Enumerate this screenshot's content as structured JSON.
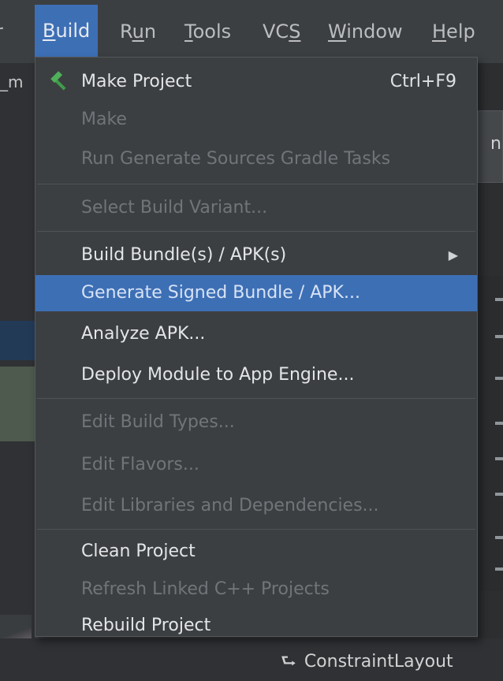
{
  "menubar": {
    "fragment": "r",
    "items": [
      "Build",
      "Run",
      "Tools",
      "VCS",
      "Window",
      "Help"
    ],
    "build": {
      "pre": "",
      "u": "B",
      "post": "uild"
    },
    "run": {
      "pre": "R",
      "u": "u",
      "post": "n"
    },
    "tools": {
      "pre": "",
      "u": "T",
      "post": "ools"
    },
    "vcs": {
      "pre": "VC",
      "u": "S",
      "post": ""
    },
    "window": {
      "pre": "",
      "u": "W",
      "post": "indow"
    },
    "help": {
      "pre": "",
      "u": "H",
      "post": "elp"
    }
  },
  "background": {
    "left_fragment": "_m",
    "right_tab": "nl",
    "constraint_label": "ConstraintLayout"
  },
  "build_menu": {
    "items": [
      {
        "label": "Make Project",
        "shortcut": "Ctrl+F9",
        "enabled": true,
        "icon": "hammer-icon"
      },
      {
        "label": "Make",
        "enabled": false
      },
      {
        "label": "Run Generate Sources Gradle Tasks",
        "enabled": false
      },
      {
        "label": "Select Build Variant...",
        "enabled": false
      },
      {
        "label": "Build Bundle(s) / APK(s)",
        "enabled": true,
        "submenu": true
      },
      {
        "label": "Generate Signed Bundle / APK...",
        "enabled": true,
        "selected": true
      },
      {
        "label": "Analyze APK...",
        "enabled": true
      },
      {
        "label": "Deploy Module to App Engine...",
        "enabled": true
      },
      {
        "label": "Edit Build Types...",
        "enabled": false
      },
      {
        "label": "Edit Flavors...",
        "enabled": false
      },
      {
        "label": "Edit Libraries and Dependencies...",
        "enabled": false
      },
      {
        "label": "Clean Project",
        "enabled": true
      },
      {
        "label": "Refresh Linked C++ Projects",
        "enabled": false
      },
      {
        "label": "Rebuild Project",
        "enabled": true
      }
    ]
  },
  "colors": {
    "menu_bg": "#3c3f41",
    "selection": "#3d6fb5",
    "disabled_text": "#70757a",
    "enabled_text": "#e3e5e7",
    "hammer": "#3f9c4a"
  }
}
